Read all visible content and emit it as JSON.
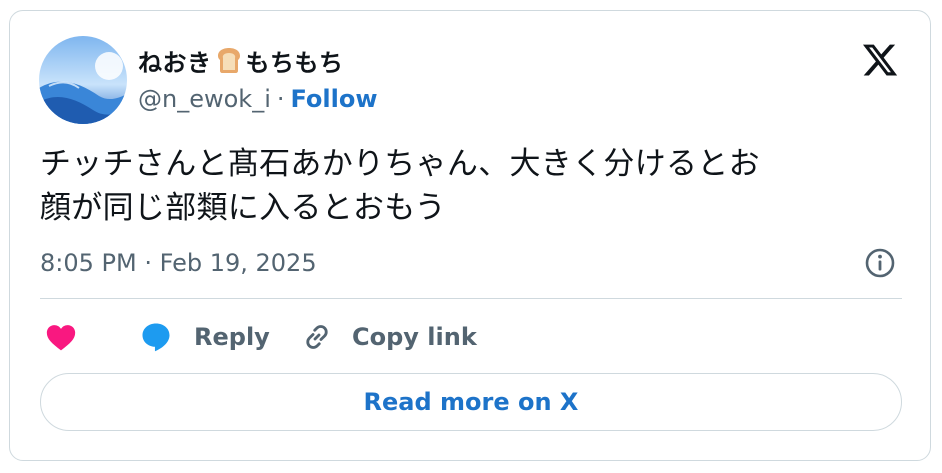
{
  "author": {
    "display_name": "ねおき",
    "name_emoji": "bread-emoji",
    "name_suffix": "もちもち",
    "handle": "@n_ewok_i",
    "separator": "·",
    "follow_label": "Follow",
    "avatar": "avatar-blue-landscape"
  },
  "logo": "x-logo-icon",
  "tweet": {
    "text_line1": "チッチさんと髙石あかりちゃん、大きく分けるとお",
    "text_line2": "顔が同じ部類に入るとおもう",
    "timestamp": "8:05 PM · Feb 19, 2025"
  },
  "actions": {
    "like_icon": "heart-icon",
    "reply_label": "Reply",
    "copy_label": "Copy link"
  },
  "read_more_label": "Read more on X",
  "colors": {
    "text": "#0f1419",
    "secondary": "#536471",
    "link": "#1d73c9",
    "heart": "#f91880",
    "reply_bubble": "#1d9bf0",
    "border": "#cfd9de"
  }
}
